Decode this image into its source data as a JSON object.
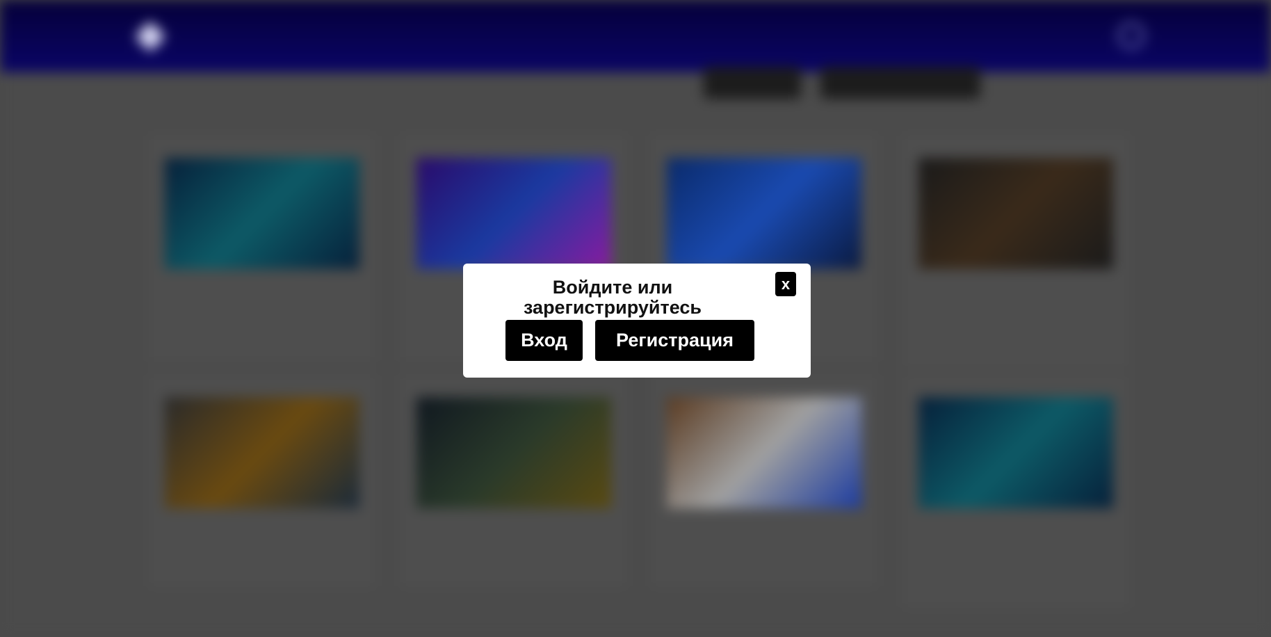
{
  "background": {
    "header": {
      "logo_icon": "diamond-icon",
      "nav_icon": "search-icon"
    },
    "cards": [
      {
        "thumb": "linear-gradient(135deg,#06203a,#0d5a66,#06203a)"
      },
      {
        "thumb": "linear-gradient(135deg,#2a0a6a,#1a3aa0,#8a1aa0)"
      },
      {
        "thumb": "linear-gradient(135deg,#0a2a6a,#1a4ab0,#0a1a40)"
      },
      {
        "thumb": "linear-gradient(135deg,#1a1a1a,#3a2a1a,#1a1a1a)"
      },
      {
        "thumb": "linear-gradient(135deg,#2a2a2a,#6a4a10,#1a2a3a)"
      },
      {
        "thumb": "linear-gradient(135deg,#101820,#2a3a2a,#5a4a10)"
      },
      {
        "thumb": "linear-gradient(135deg,#5a3a20,#a0a0a0,#1a3aa0)"
      },
      {
        "thumb": "linear-gradient(135deg,#06203a,#0d5a66,#06203a)"
      }
    ]
  },
  "modal": {
    "title": "Войдите или зарегистрируйтесь",
    "close_label": "x",
    "login_label": "Вход",
    "register_label": "Регистрация"
  },
  "colors": {
    "header": "#05003a",
    "overlay": "#4a4a4a",
    "modal_bg": "#ffffff",
    "button_bg": "#000000"
  }
}
